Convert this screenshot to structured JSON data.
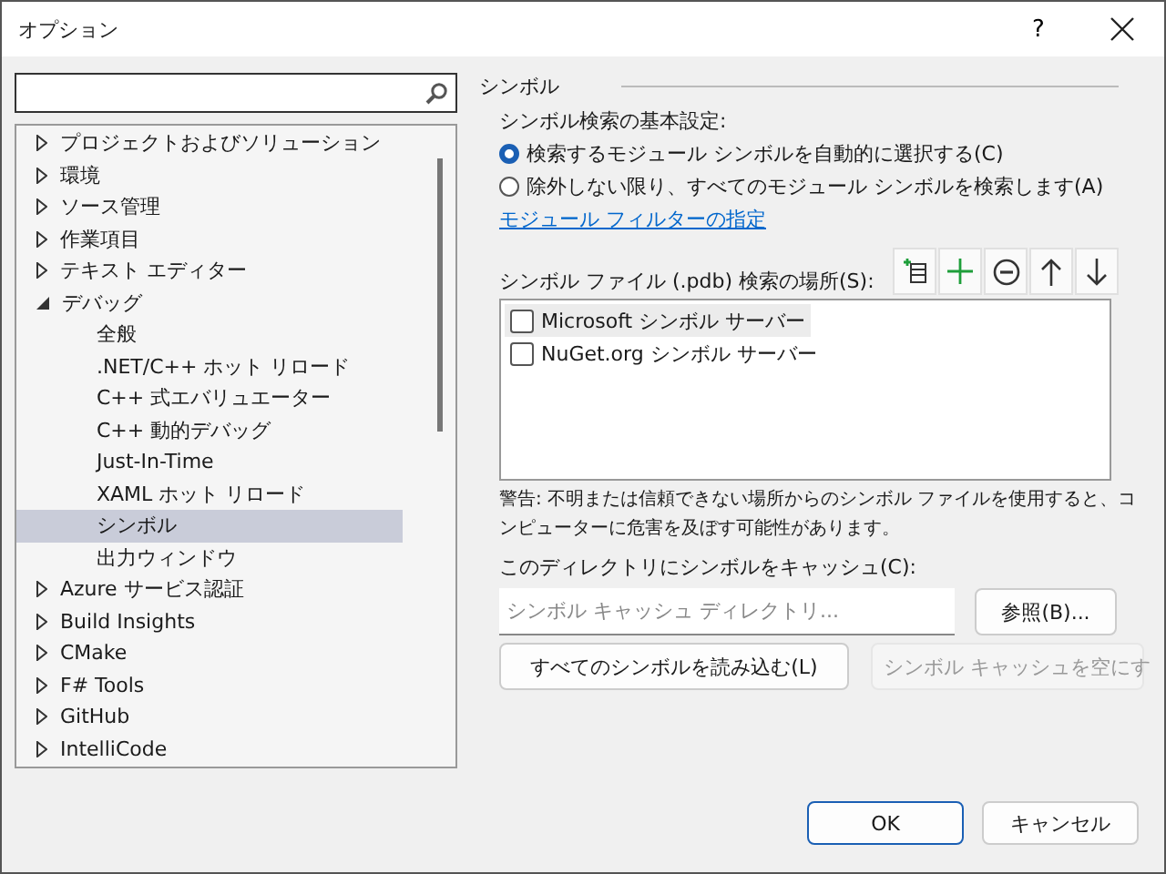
{
  "window": {
    "title": "オプション",
    "help_button": "?"
  },
  "tree": [
    {
      "label": "プロジェクトおよびソリューション",
      "expanded": false,
      "selected": false
    },
    {
      "label": "環境",
      "expanded": false,
      "selected": false
    },
    {
      "label": "ソース管理",
      "expanded": false,
      "selected": false
    },
    {
      "label": "作業項目",
      "expanded": false,
      "selected": false
    },
    {
      "label": "テキスト エディター",
      "expanded": false,
      "selected": false
    },
    {
      "label": "デバッグ",
      "expanded": true,
      "selected": false,
      "children": [
        {
          "label": "全般",
          "selected": false
        },
        {
          "label": ".NET/C++ ホット リロード",
          "selected": false
        },
        {
          "label": "C++ 式エバリュエーター",
          "selected": false
        },
        {
          "label": "C++ 動的デバッグ",
          "selected": false
        },
        {
          "label": "Just-In-Time",
          "selected": false
        },
        {
          "label": "XAML ホット リロード",
          "selected": false
        },
        {
          "label": "シンボル",
          "selected": true
        },
        {
          "label": "出力ウィンドウ",
          "selected": false
        }
      ]
    },
    {
      "label": "Azure サービス認証",
      "expanded": false,
      "selected": false
    },
    {
      "label": "Build Insights",
      "expanded": false,
      "selected": false
    },
    {
      "label": "CMake",
      "expanded": false,
      "selected": false
    },
    {
      "label": "F# Tools",
      "expanded": false,
      "selected": false
    },
    {
      "label": "GitHub",
      "expanded": false,
      "selected": false
    },
    {
      "label": "IntelliCode",
      "expanded": false,
      "selected": false
    }
  ],
  "panel": {
    "heading": "シンボル",
    "search_settings_label": "シンボル検索の基本設定:",
    "radios": [
      {
        "label": "検索するモジュール シンボルを自動的に選択する(C)",
        "selected": true
      },
      {
        "label": "除外しない限り、すべてのモジュール シンボルを検索します(A)",
        "selected": false
      }
    ],
    "filter_link": "モジュール フィルターの指定",
    "locations_label": "シンボル ファイル (.pdb) 検索の場所(S):",
    "locations": [
      {
        "label": "Microsoft シンボル サーバー",
        "checked": false,
        "selected": true
      },
      {
        "label": "NuGet.org シンボル サーバー",
        "checked": false,
        "selected": false
      }
    ],
    "warning": "警告: 不明または信頼できない場所からのシンボル ファイルを使用すると、コンピューターに危害を及ぼす可能性があります。",
    "cache_label": "このディレクトリにシンボルをキャッシュ(C):",
    "cache_field": {
      "placeholder": "シンボル キャッシュ ディレクトリ..."
    },
    "browse_button": "参照(B)...",
    "buttons": [
      {
        "label": "すべてのシンボルを読み込む(L)",
        "disabled": false
      },
      {
        "label": "シンボル キャッシュを空にす",
        "disabled": true
      }
    ]
  },
  "footer_buttons": [
    {
      "label": "OK",
      "default": true
    },
    {
      "label": "キャンセル",
      "default": false
    }
  ]
}
